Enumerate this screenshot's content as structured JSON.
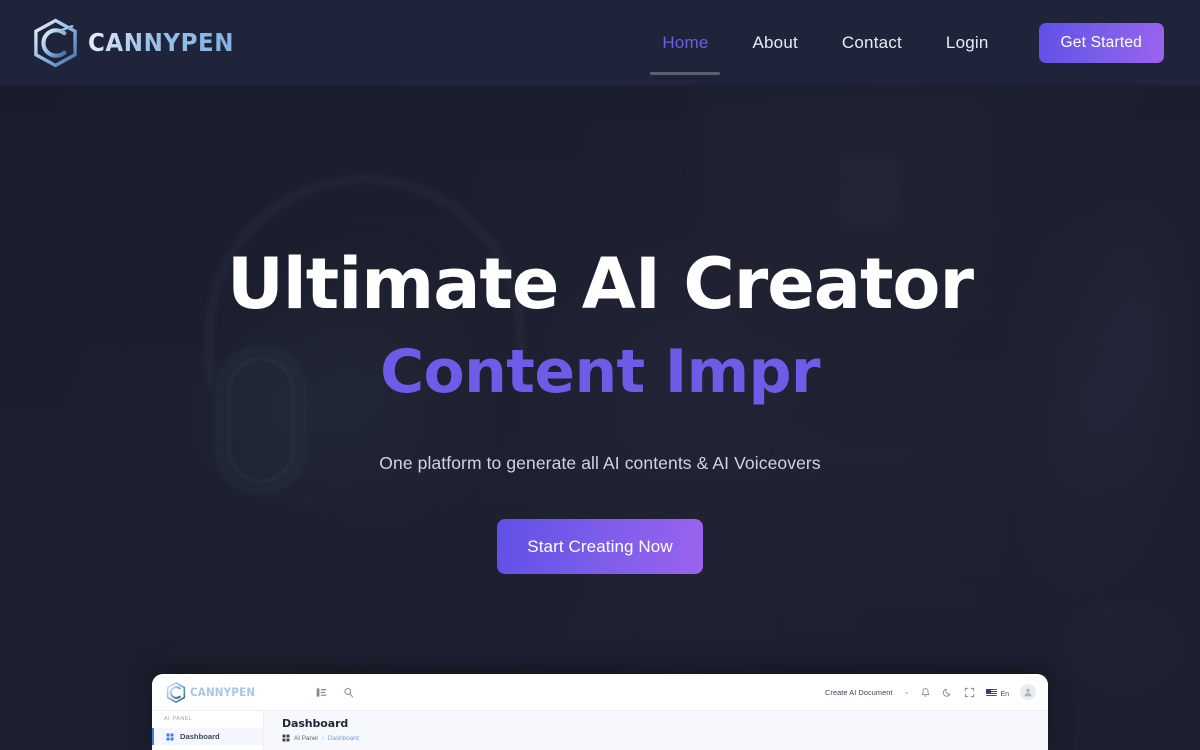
{
  "brand": {
    "name": "CANNYPEN",
    "mark_icon": "hex-c-logo-icon"
  },
  "nav": {
    "links": [
      {
        "label": "Home",
        "active": true
      },
      {
        "label": "About",
        "active": false
      },
      {
        "label": "Contact",
        "active": false
      },
      {
        "label": "Login",
        "active": false
      }
    ],
    "cta_label": "Get Started"
  },
  "hero": {
    "title": "Ultimate AI Creator",
    "typed_text": "Content Impr",
    "subtitle": "One platform to generate all AI contents & AI Voiceovers",
    "cta_label": "Start Creating Now"
  },
  "dashboard_preview": {
    "brand_name": "CANNYPEN",
    "toolbar_icons": [
      "sidebar-toggle-icon",
      "search-icon"
    ],
    "create_label": "Create AI Document",
    "chevron": "⌄",
    "right_icons": [
      "bell-icon",
      "moon-icon",
      "fullscreen-icon"
    ],
    "language": "En",
    "avatar_icon": "user-avatar-icon",
    "sidebar": {
      "section_label": "AI PANEL",
      "items": [
        {
          "label": "Dashboard",
          "icon": "grid-icon",
          "active": true
        }
      ]
    },
    "main": {
      "heading": "Dashboard",
      "breadcrumb": {
        "icon": "grid-icon",
        "root": "AI Panel",
        "separator": "›",
        "current": "Dashboard"
      }
    }
  },
  "colors": {
    "page_bg": "#1e2233",
    "header_bg": "#20243a",
    "accent_purple": "#6c5ce7",
    "gradient_start": "#6050e8",
    "gradient_end": "#9b63ef",
    "heading_white": "#ffffff",
    "subtitle_grey": "#cfd4e2"
  }
}
